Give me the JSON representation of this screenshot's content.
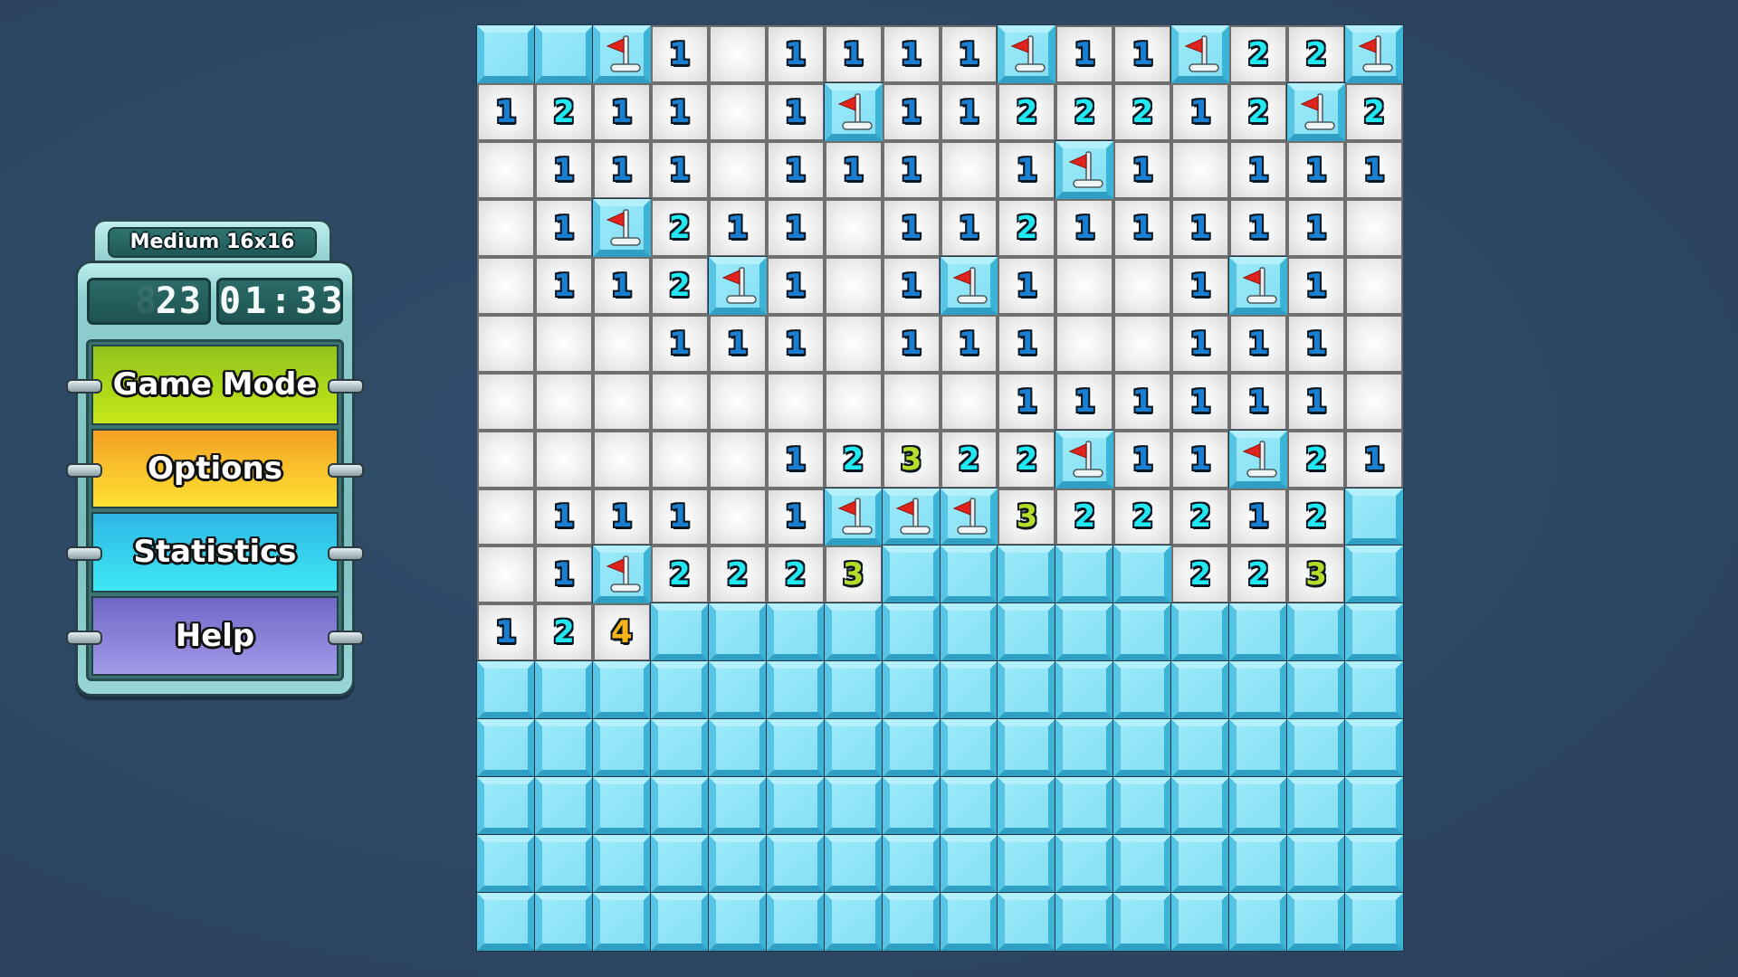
{
  "sidebar": {
    "mode_label": "Medium 16x16",
    "mine_counter": "23",
    "timer": "01:33",
    "buttons": [
      {
        "label": "Game Mode",
        "color": "#a5d41c"
      },
      {
        "label": "Options",
        "color": "#f9c22c"
      },
      {
        "label": "Statistics",
        "color": "#36d0ee"
      },
      {
        "label": "Help",
        "color": "#8981d8"
      }
    ]
  },
  "board": {
    "rows": 16,
    "cols": 16,
    "legend": {
      "U": "unrevealed",
      "E": "empty-revealed",
      "F": "flagged",
      "1-8": "adjacent mine count"
    },
    "number_colors": {
      "1": "#1a7fd0",
      "2": "#22e8f2",
      "3": "#b4dc2a",
      "4": "#f6b21a"
    },
    "cells": [
      [
        "U",
        "U",
        "F",
        "1",
        "E",
        "1",
        "1",
        "1",
        "1",
        "F",
        "1",
        "1",
        "F",
        "2",
        "2",
        "F"
      ],
      [
        "1",
        "2",
        "1",
        "1",
        "E",
        "1",
        "F",
        "1",
        "1",
        "2",
        "2",
        "2",
        "1",
        "2",
        "F",
        "2"
      ],
      [
        "E",
        "1",
        "1",
        "1",
        "E",
        "1",
        "1",
        "1",
        "E",
        "1",
        "F",
        "1",
        "E",
        "1",
        "1",
        "1"
      ],
      [
        "E",
        "1",
        "F",
        "2",
        "1",
        "1",
        "E",
        "1",
        "1",
        "2",
        "1",
        "1",
        "1",
        "1",
        "1",
        "E"
      ],
      [
        "E",
        "1",
        "1",
        "2",
        "F",
        "1",
        "E",
        "1",
        "F",
        "1",
        "E",
        "E",
        "1",
        "F",
        "1",
        "E"
      ],
      [
        "E",
        "E",
        "E",
        "1",
        "1",
        "1",
        "E",
        "1",
        "1",
        "1",
        "E",
        "E",
        "1",
        "1",
        "1",
        "E"
      ],
      [
        "E",
        "E",
        "E",
        "E",
        "E",
        "E",
        "E",
        "E",
        "E",
        "1",
        "1",
        "1",
        "1",
        "1",
        "1",
        "E"
      ],
      [
        "E",
        "E",
        "E",
        "E",
        "E",
        "1",
        "2",
        "3",
        "2",
        "2",
        "F",
        "1",
        "1",
        "F",
        "2",
        "1"
      ],
      [
        "E",
        "1",
        "1",
        "1",
        "E",
        "1",
        "F",
        "F",
        "F",
        "3",
        "2",
        "2",
        "2",
        "1",
        "2",
        "U"
      ],
      [
        "E",
        "1",
        "F",
        "2",
        "2",
        "2",
        "3",
        "U",
        "U",
        "U",
        "U",
        "U",
        "2",
        "2",
        "3",
        "U"
      ],
      [
        "1",
        "2",
        "4",
        "U",
        "U",
        "U",
        "U",
        "U",
        "U",
        "U",
        "U",
        "U",
        "U",
        "U",
        "U",
        "U"
      ],
      [
        "U",
        "U",
        "U",
        "U",
        "U",
        "U",
        "U",
        "U",
        "U",
        "U",
        "U",
        "U",
        "U",
        "U",
        "U",
        "U"
      ],
      [
        "U",
        "U",
        "U",
        "U",
        "U",
        "U",
        "U",
        "U",
        "U",
        "U",
        "U",
        "U",
        "U",
        "U",
        "U",
        "U"
      ],
      [
        "U",
        "U",
        "U",
        "U",
        "U",
        "U",
        "U",
        "U",
        "U",
        "U",
        "U",
        "U",
        "U",
        "U",
        "U",
        "U"
      ],
      [
        "U",
        "U",
        "U",
        "U",
        "U",
        "U",
        "U",
        "U",
        "U",
        "U",
        "U",
        "U",
        "U",
        "U",
        "U",
        "U"
      ],
      [
        "U",
        "U",
        "U",
        "U",
        "U",
        "U",
        "U",
        "U",
        "U",
        "U",
        "U",
        "U",
        "U",
        "U",
        "U",
        "U"
      ]
    ]
  }
}
